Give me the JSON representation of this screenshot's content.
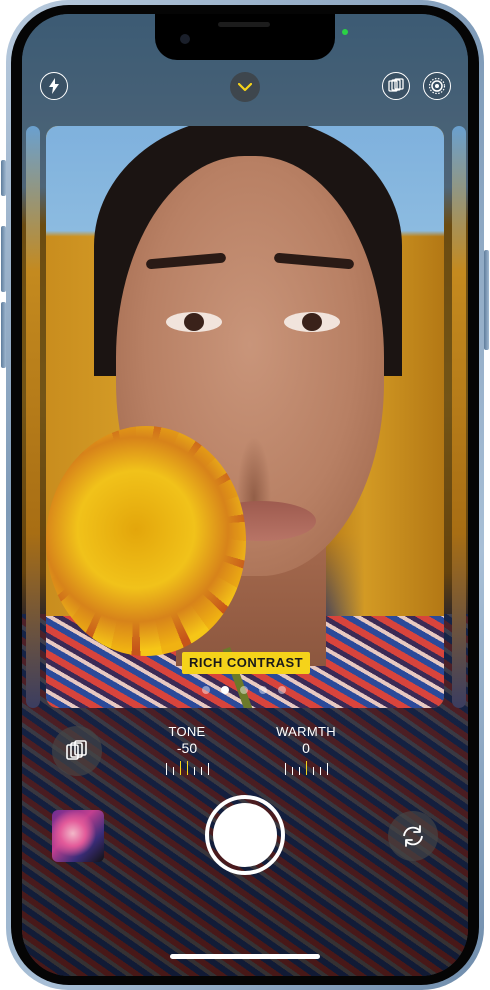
{
  "camera": {
    "style_name": "RICH CONTRAST",
    "style_page_count": 5,
    "style_active_index": 1,
    "tone": {
      "label": "TONE",
      "value": "-50"
    },
    "warmth": {
      "label": "WARMTH",
      "value": "0"
    }
  },
  "top_controls": {
    "flash_icon": "lightning-bolt-icon",
    "expand_icon": "chevron-down-icon",
    "styles_icon": "photographic-styles-icon",
    "live_icon": "live-photo-icon"
  },
  "bottom_controls": {
    "styles_button_icon": "photographic-styles-icon",
    "shutter_icon": "shutter",
    "flip_icon": "camera-flip-icon"
  },
  "colors": {
    "accent_yellow": "#f5d31a",
    "indicator_green": "#2ad245",
    "frame": "#8ea8c3"
  }
}
